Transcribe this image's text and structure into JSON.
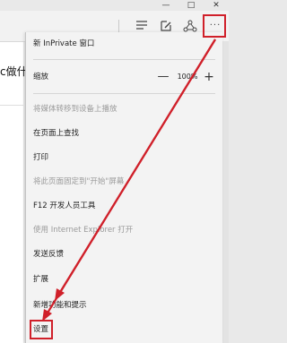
{
  "window": {
    "minimize_icon": "minimize-icon",
    "maximize_icon": "maximize-icon",
    "close_icon": "close-icon"
  },
  "toolbar": {
    "icons": [
      "hub-icon",
      "web-note-icon",
      "share-icon",
      "more-actions-icon"
    ],
    "more_label": "···"
  },
  "page": {
    "partial_text": "c做什"
  },
  "menu": {
    "new_inprivate": "新 InPrivate 窗口",
    "zoom_label": "缩放",
    "zoom_minus": "—",
    "zoom_value": "100%",
    "zoom_plus": "+",
    "cast_media": "将媒体转移到设备上播放",
    "find_on_page": "在页面上查找",
    "print": "打印",
    "pin_to_start": "将此页面固定到\"开始\"屏幕",
    "f12_tools": "F12 开发人员工具",
    "open_with_ie": "使用 Internet Explorer 打开",
    "send_feedback": "发送反馈",
    "extensions": "扩展",
    "whats_new": "新增功能和提示",
    "settings": "设置"
  },
  "annotation": {
    "color": "#d0202a"
  }
}
